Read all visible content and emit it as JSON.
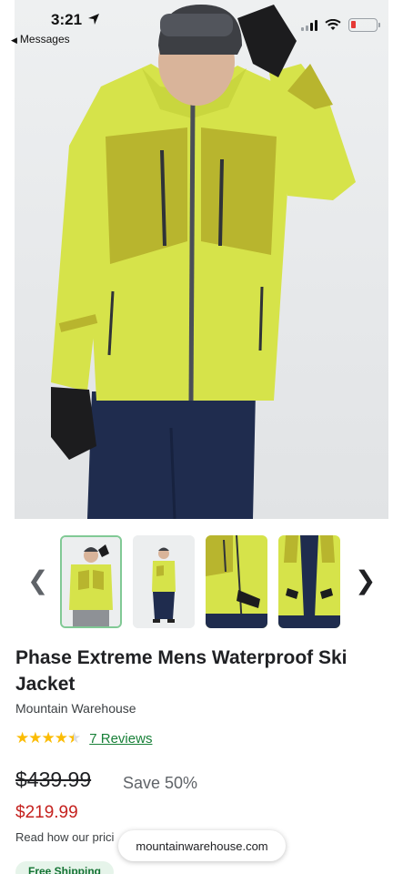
{
  "status_bar": {
    "time": "3:21",
    "back_label": "Messages"
  },
  "product": {
    "title": "Phase Extreme Mens Waterproof Ski Jacket",
    "merchant": "Mountain Warehouse",
    "rating": 4.5,
    "stars_display": "★★★★★",
    "reviews_label": "7 Reviews",
    "original_price": "$439.99",
    "discount": "Save 50%",
    "price": "$219.99",
    "pricing_note": "Read how our prici",
    "shipping_badge": "Free Shipping"
  },
  "browser": {
    "url": "mountainwarehouse.com"
  },
  "gallery": {
    "prev_icon": "chevron-left-icon",
    "next_icon": "chevron-right-icon",
    "selected_index": 0,
    "thumbnail_count": 4
  },
  "colors": {
    "jacket_lime": "#d6e34a",
    "jacket_olive": "#b8b52e",
    "pants_navy": "#1f2c4e",
    "review_link": "#188038",
    "sale_price": "#c5221f",
    "star": "#fbbc04",
    "selected_border": "#81c995"
  }
}
